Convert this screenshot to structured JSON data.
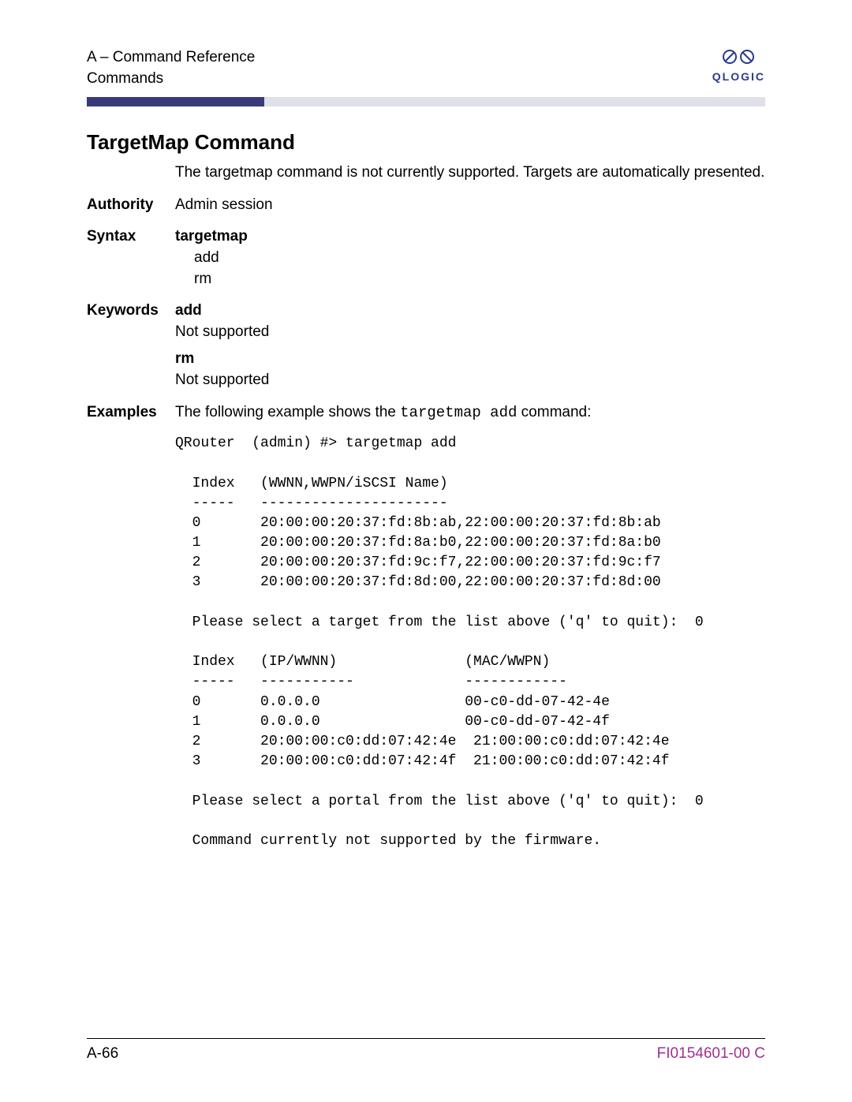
{
  "header": {
    "line1": "A – Command Reference",
    "line2": "Commands",
    "logo_text": "QLOGIC"
  },
  "title": "TargetMap Command",
  "intro": "The targetmap command is not currently supported. Targets are automatically presented.",
  "sections": {
    "authority_label": "Authority",
    "authority_value": "Admin session",
    "syntax_label": "Syntax",
    "syntax_kw": "targetmap",
    "syntax_opts": [
      "add",
      "rm"
    ],
    "keywords_label": "Keywords",
    "kw_add": "add",
    "kw_add_desc": "Not supported",
    "kw_rm": "rm",
    "kw_rm_desc": "Not supported",
    "examples_label": "Examples",
    "examples_intro_pre": "The following example shows the ",
    "examples_intro_code": "targetmap add",
    "examples_intro_post": " command:"
  },
  "code": "QRouter  (admin) #> targetmap add\n\n  Index   (WWNN,WWPN/iSCSI Name)\n  -----   ----------------------\n  0       20:00:00:20:37:fd:8b:ab,22:00:00:20:37:fd:8b:ab\n  1       20:00:00:20:37:fd:8a:b0,22:00:00:20:37:fd:8a:b0\n  2       20:00:00:20:37:fd:9c:f7,22:00:00:20:37:fd:9c:f7\n  3       20:00:00:20:37:fd:8d:00,22:00:00:20:37:fd:8d:00\n\n  Please select a target from the list above ('q' to quit):  0\n\n  Index   (IP/WWNN)               (MAC/WWPN)\n  -----   -----------             ------------\n  0       0.0.0.0                 00-c0-dd-07-42-4e\n  1       0.0.0.0                 00-c0-dd-07-42-4f\n  2       20:00:00:c0:dd:07:42:4e  21:00:00:c0:dd:07:42:4e\n  3       20:00:00:c0:dd:07:42:4f  21:00:00:c0:dd:07:42:4f\n\n  Please select a portal from the list above ('q' to quit):  0\n\n  Command currently not supported by the firmware.",
  "footer": {
    "left": "A-66",
    "right": "FI0154601-00  C"
  }
}
